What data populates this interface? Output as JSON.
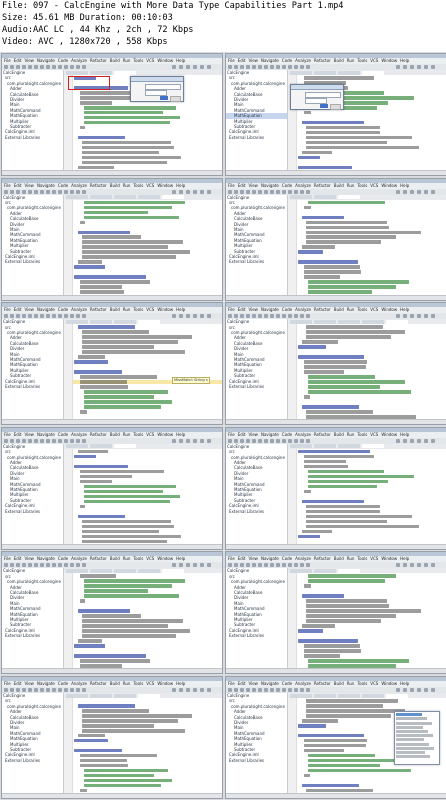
{
  "video_info": {
    "file_line": "File: 097 - CalcEngine with More Data Type Capabilities Part 1.mp4",
    "size_line": "Size: 45.61 MB Duration: 00:10:03",
    "audio_line": "Audio:AAC LC , 44 Khz , 2ch , 72 Kbps",
    "video_line": "Video: AVC , 1280x720 , 558 Kbps"
  },
  "ide": {
    "menu": [
      "File",
      "Edit",
      "View",
      "Navigate",
      "Code",
      "Analyze",
      "Refactor",
      "Build",
      "Run",
      "Tools",
      "VCS",
      "Window",
      "Help"
    ],
    "project_tree": [
      "CalcEngine",
      "src",
      "com.pluralsight.calcengine",
      "Adder",
      "CalculateBase",
      "Divider",
      "Main",
      "MathCommand",
      "MathEquation",
      "Multiplier",
      "Subtracter",
      "CalcEngine.iml",
      "External Libraries"
    ]
  },
  "thumbnails": [
    {
      "id": 1,
      "dialog": "new-class",
      "red_box": true
    },
    {
      "id": 2,
      "dialog": "new-class"
    },
    {
      "id": 3
    },
    {
      "id": 4
    },
    {
      "id": 5,
      "tooltip": "MissMatch String s"
    },
    {
      "id": 6
    },
    {
      "id": 7
    },
    {
      "id": 8
    },
    {
      "id": 9
    },
    {
      "id": 10
    },
    {
      "id": 11
    },
    {
      "id": 12,
      "popup": "autocomplete"
    }
  ]
}
